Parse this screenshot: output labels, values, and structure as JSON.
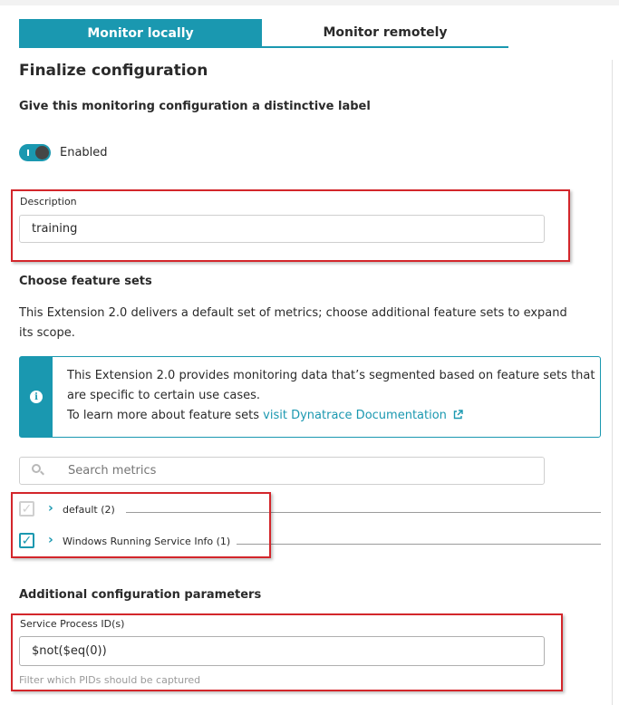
{
  "tabs": {
    "local": "Monitor locally",
    "remote": "Monitor remotely"
  },
  "section_title": "Finalize configuration",
  "label_prompt": "Give this monitoring configuration a distinctive label",
  "toggle": {
    "label": "Enabled",
    "state": "on"
  },
  "description": {
    "label": "Description",
    "value": "training"
  },
  "feature_sets": {
    "heading": "Choose feature sets",
    "intro_line1": "This Extension 2.0 delivers a default set of metrics; choose additional feature sets to expand",
    "intro_line2": "its scope.",
    "info_line1": "This Extension 2.0 provides monitoring data that’s segmented based on feature sets that",
    "info_line2": "are specific to certain use cases.",
    "info_line3_prefix": "To learn more about feature sets ",
    "info_link": "visit Dynatrace Documentation",
    "search_placeholder": "Search metrics",
    "items": [
      {
        "label": "default (2)",
        "checked": true,
        "disabled": true
      },
      {
        "label": "Windows Running Service Info (1)",
        "checked": true,
        "disabled": false
      }
    ]
  },
  "additional": {
    "heading": "Additional configuration parameters",
    "field_label": "Service Process ID(s)",
    "field_value": "$not($eq(0))",
    "helper": "Filter which PIDs should be captured"
  },
  "colors": {
    "accent": "#1a98b0",
    "annotation_red": "#d3262b"
  }
}
